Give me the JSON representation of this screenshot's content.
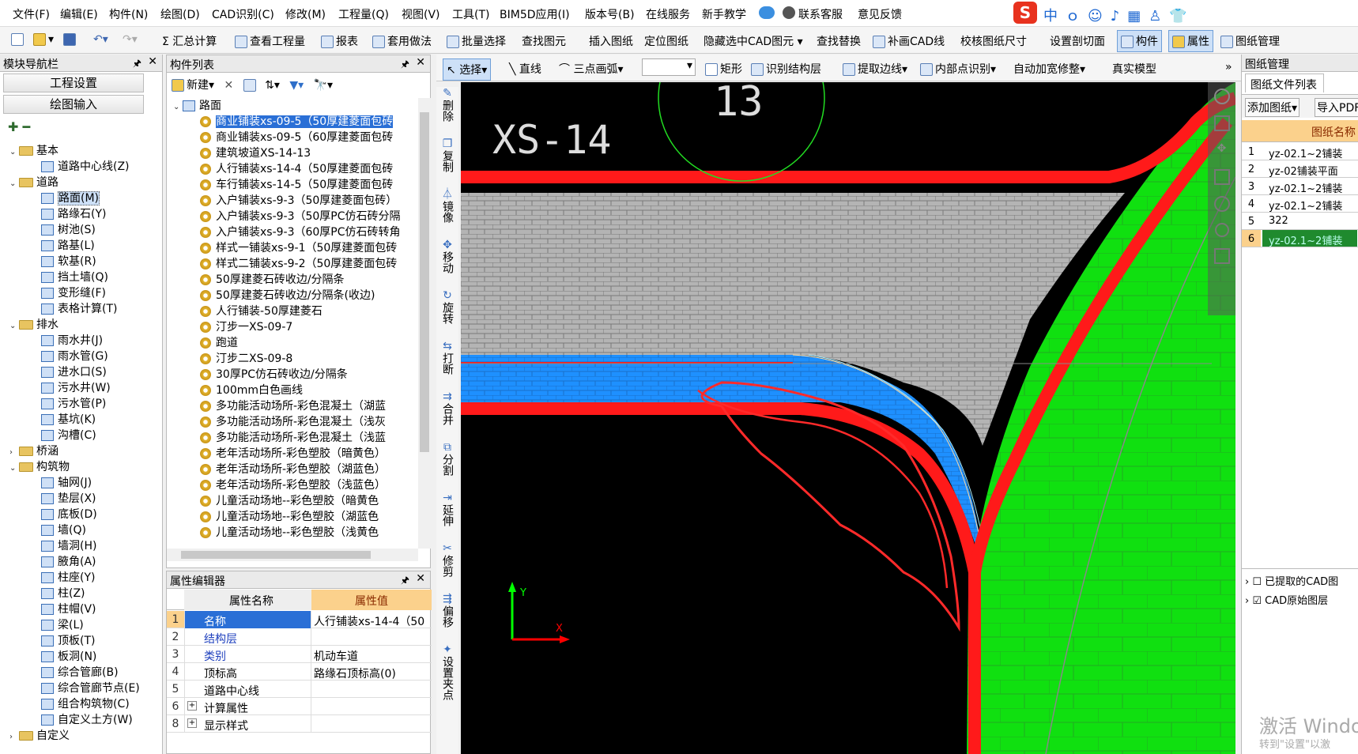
{
  "menu": [
    "文件(F)",
    "编辑(E)",
    "构件(N)",
    "绘图(D)",
    "CAD识别(C)",
    "修改(M)",
    "工程量(Q)",
    "视图(V)",
    "工具(T)",
    "BIM5D应用(I)",
    "版本号(B)",
    "在线服务",
    "新手教学",
    "联系客服",
    "意见反馈"
  ],
  "toolbar": [
    "汇总计算",
    "查看工程量",
    "报表",
    "套用做法",
    "批量选择",
    "查找图元",
    "插入图纸",
    "定位图纸",
    "隐藏选中CAD图元",
    "查找替换",
    "补画CAD线",
    "校核图纸尺寸",
    "设置剖切面",
    "构件",
    "属性",
    "图纸管理"
  ],
  "draw_toolbar": [
    "选择",
    "直线",
    "三点画弧",
    "矩形",
    "识别结构层",
    "提取边线",
    "内部点识别",
    "自动加宽修整",
    "真实模型"
  ],
  "modnav": {
    "title": "模块导航栏",
    "buttons": [
      "工程设置",
      "绘图输入"
    ]
  },
  "tree": [
    {
      "label": "基本",
      "level": 0,
      "folder": true
    },
    {
      "label": "道路中心线(Z)",
      "level": 2
    },
    {
      "label": "道路",
      "level": 0,
      "folder": true
    },
    {
      "label": "路面(M)",
      "level": 2,
      "selected": true
    },
    {
      "label": "路缘石(Y)",
      "level": 2
    },
    {
      "label": "树池(S)",
      "level": 2
    },
    {
      "label": "路基(L)",
      "level": 2
    },
    {
      "label": "软基(R)",
      "level": 2
    },
    {
      "label": "挡土墙(Q)",
      "level": 2
    },
    {
      "label": "变形缝(F)",
      "level": 2
    },
    {
      "label": "表格计算(T)",
      "level": 2
    },
    {
      "label": "排水",
      "level": 0,
      "folder": true
    },
    {
      "label": "雨水井(J)",
      "level": 2
    },
    {
      "label": "雨水管(G)",
      "level": 2
    },
    {
      "label": "进水口(S)",
      "level": 2
    },
    {
      "label": "污水井(W)",
      "level": 2
    },
    {
      "label": "污水管(P)",
      "level": 2
    },
    {
      "label": "基坑(K)",
      "level": 2
    },
    {
      "label": "沟槽(C)",
      "level": 2
    },
    {
      "label": "桥涵",
      "level": 0,
      "folder": true,
      "collapsed": true
    },
    {
      "label": "构筑物",
      "level": 0,
      "folder": true
    },
    {
      "label": "轴网(J)",
      "level": 2
    },
    {
      "label": "垫层(X)",
      "level": 2
    },
    {
      "label": "底板(D)",
      "level": 2
    },
    {
      "label": "墙(Q)",
      "level": 2
    },
    {
      "label": "墙洞(H)",
      "level": 2
    },
    {
      "label": "腋角(A)",
      "level": 2
    },
    {
      "label": "柱座(Y)",
      "level": 2
    },
    {
      "label": "柱(Z)",
      "level": 2
    },
    {
      "label": "柱帽(V)",
      "level": 2
    },
    {
      "label": "梁(L)",
      "level": 2
    },
    {
      "label": "顶板(T)",
      "level": 2
    },
    {
      "label": "板洞(N)",
      "level": 2
    },
    {
      "label": "综合管廊(B)",
      "level": 2
    },
    {
      "label": "综合管廊节点(E)",
      "level": 2
    },
    {
      "label": "组合构筑物(C)",
      "level": 2
    },
    {
      "label": "自定义土方(W)",
      "level": 2
    },
    {
      "label": "自定义",
      "level": 0,
      "folder": true,
      "collapsed": true
    }
  ],
  "complist": {
    "title": "构件列表",
    "new_label": "新建",
    "root": "路面",
    "items": [
      "商业铺装xs-09-5（50厚建菱面包砖",
      "商业铺装xs-09-5（60厚建菱面包砖",
      "建筑坡道XS-14-13",
      "人行铺装xs-14-4（50厚建菱面包砖",
      "车行铺装xs-14-5（50厚建菱面包砖",
      "入户铺装xs-9-3（50厚建菱面包砖）",
      "入户铺装xs-9-3（50厚PC仿石砖分隔",
      "入户铺装xs-9-3（60厚PC仿石砖转角",
      "样式一铺装xs-9-1（50厚建菱面包砖",
      "样式二铺装xs-9-2（50厚建菱面包砖",
      "50厚建菱石砖收边/分隔条",
      "50厚建菱石砖收边/分隔条(收边)",
      "人行铺装-50厚建菱石",
      "汀步一XS-09-7",
      "跑道",
      "汀步二XS-09-8",
      "30厚PC仿石砖收边/分隔条",
      "100mm白色画线",
      "多功能活动场所-彩色混凝土（湖蓝",
      "多功能活动场所-彩色混凝土（浅灰",
      "多功能活动场所-彩色混凝土（浅蓝",
      "老年活动场所-彩色塑胶（暗黄色）",
      "老年活动场所-彩色塑胶（湖蓝色）",
      "老年活动场所-彩色塑胶（浅蓝色）",
      "儿童活动场地--彩色塑胶（暗黄色",
      "儿童活动场地--彩色塑胶（湖蓝色",
      "儿童活动场地--彩色塑胶（浅黄色"
    ]
  },
  "vertical_tools": [
    "删除",
    "复制",
    "镜像",
    "移动",
    "旋转",
    "打断",
    "合并",
    "分割",
    "延伸",
    "修剪",
    "偏移",
    "设置夹点"
  ],
  "props": {
    "title": "属性编辑器",
    "col_name": "属性名称",
    "col_value": "属性值",
    "rows": [
      {
        "n": "1",
        "k": "名称",
        "v": "人行铺装xs-14-4（50",
        "blue": true,
        "sel": true
      },
      {
        "n": "2",
        "k": "结构层",
        "v": "",
        "blue": true
      },
      {
        "n": "3",
        "k": "类别",
        "v": "机动车道",
        "blue": true
      },
      {
        "n": "4",
        "k": "顶标高",
        "v": "路缘石顶标高(0)"
      },
      {
        "n": "5",
        "k": "道路中心线",
        "v": ""
      },
      {
        "n": "6",
        "k": "计算属性",
        "v": "",
        "plus": true
      },
      {
        "n": "8",
        "k": "显示样式",
        "v": "",
        "plus": true
      }
    ]
  },
  "canvas": {
    "label": "XS-14",
    "circle_num": "13",
    "axis_y": "Y",
    "axis_x": "X"
  },
  "drawing_mgr": {
    "title": "图纸管理",
    "tab": "图纸文件列表",
    "add": "添加图纸",
    "import": "导入PDF",
    "col": "图纸名称",
    "rows": [
      {
        "n": "1",
        "name": "yz-02.1~2铺装"
      },
      {
        "n": "2",
        "name": "yz-02铺装平面"
      },
      {
        "n": "3",
        "name": "yz-02.1~2铺装"
      },
      {
        "n": "4",
        "name": "yz-02.1~2铺装"
      },
      {
        "n": "5",
        "name": "322"
      },
      {
        "n": "6",
        "name": "yz-02.1~2铺装",
        "selected": true
      }
    ],
    "layers": [
      "已提取的CAD图",
      "CAD原始图层"
    ]
  },
  "watermark": {
    "line1": "激活 Windo",
    "line2": "转到\"设置\"以激"
  }
}
